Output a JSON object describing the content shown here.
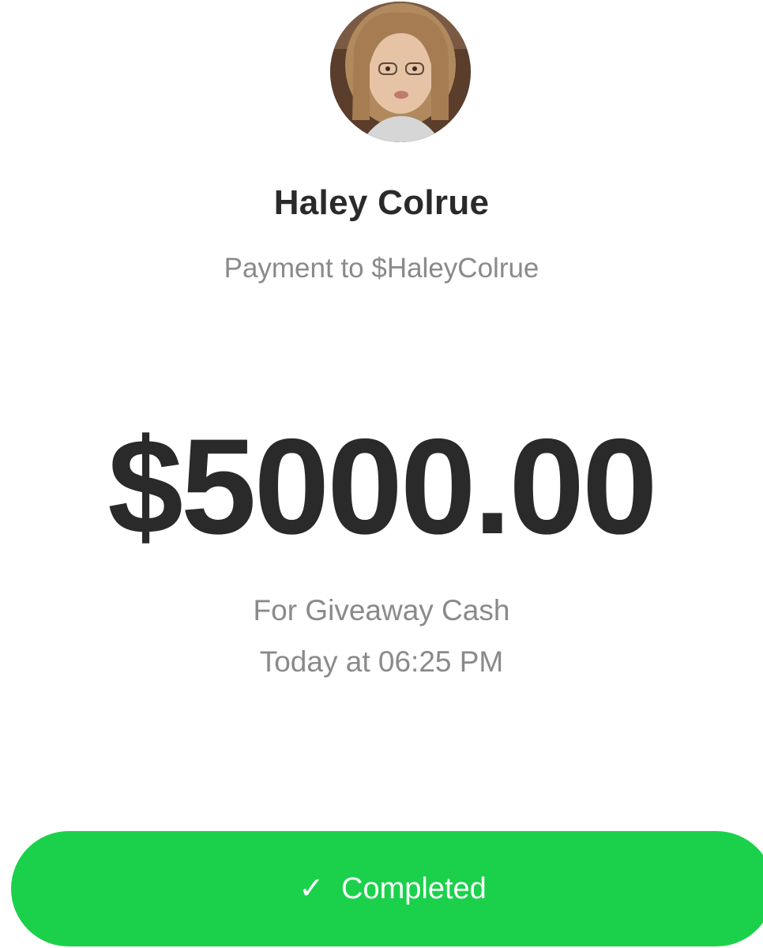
{
  "recipient": {
    "name": "Haley Colrue",
    "subtitle": "Payment to $HaleyColrue",
    "avatar_icon": "avatar-photo"
  },
  "payment": {
    "amount": "$5000.00",
    "note": "For Giveaway Cash",
    "timestamp": "Today at 06:25 PM"
  },
  "status": {
    "label": "Completed",
    "icon": "check-icon",
    "color": "#1bd14b"
  }
}
